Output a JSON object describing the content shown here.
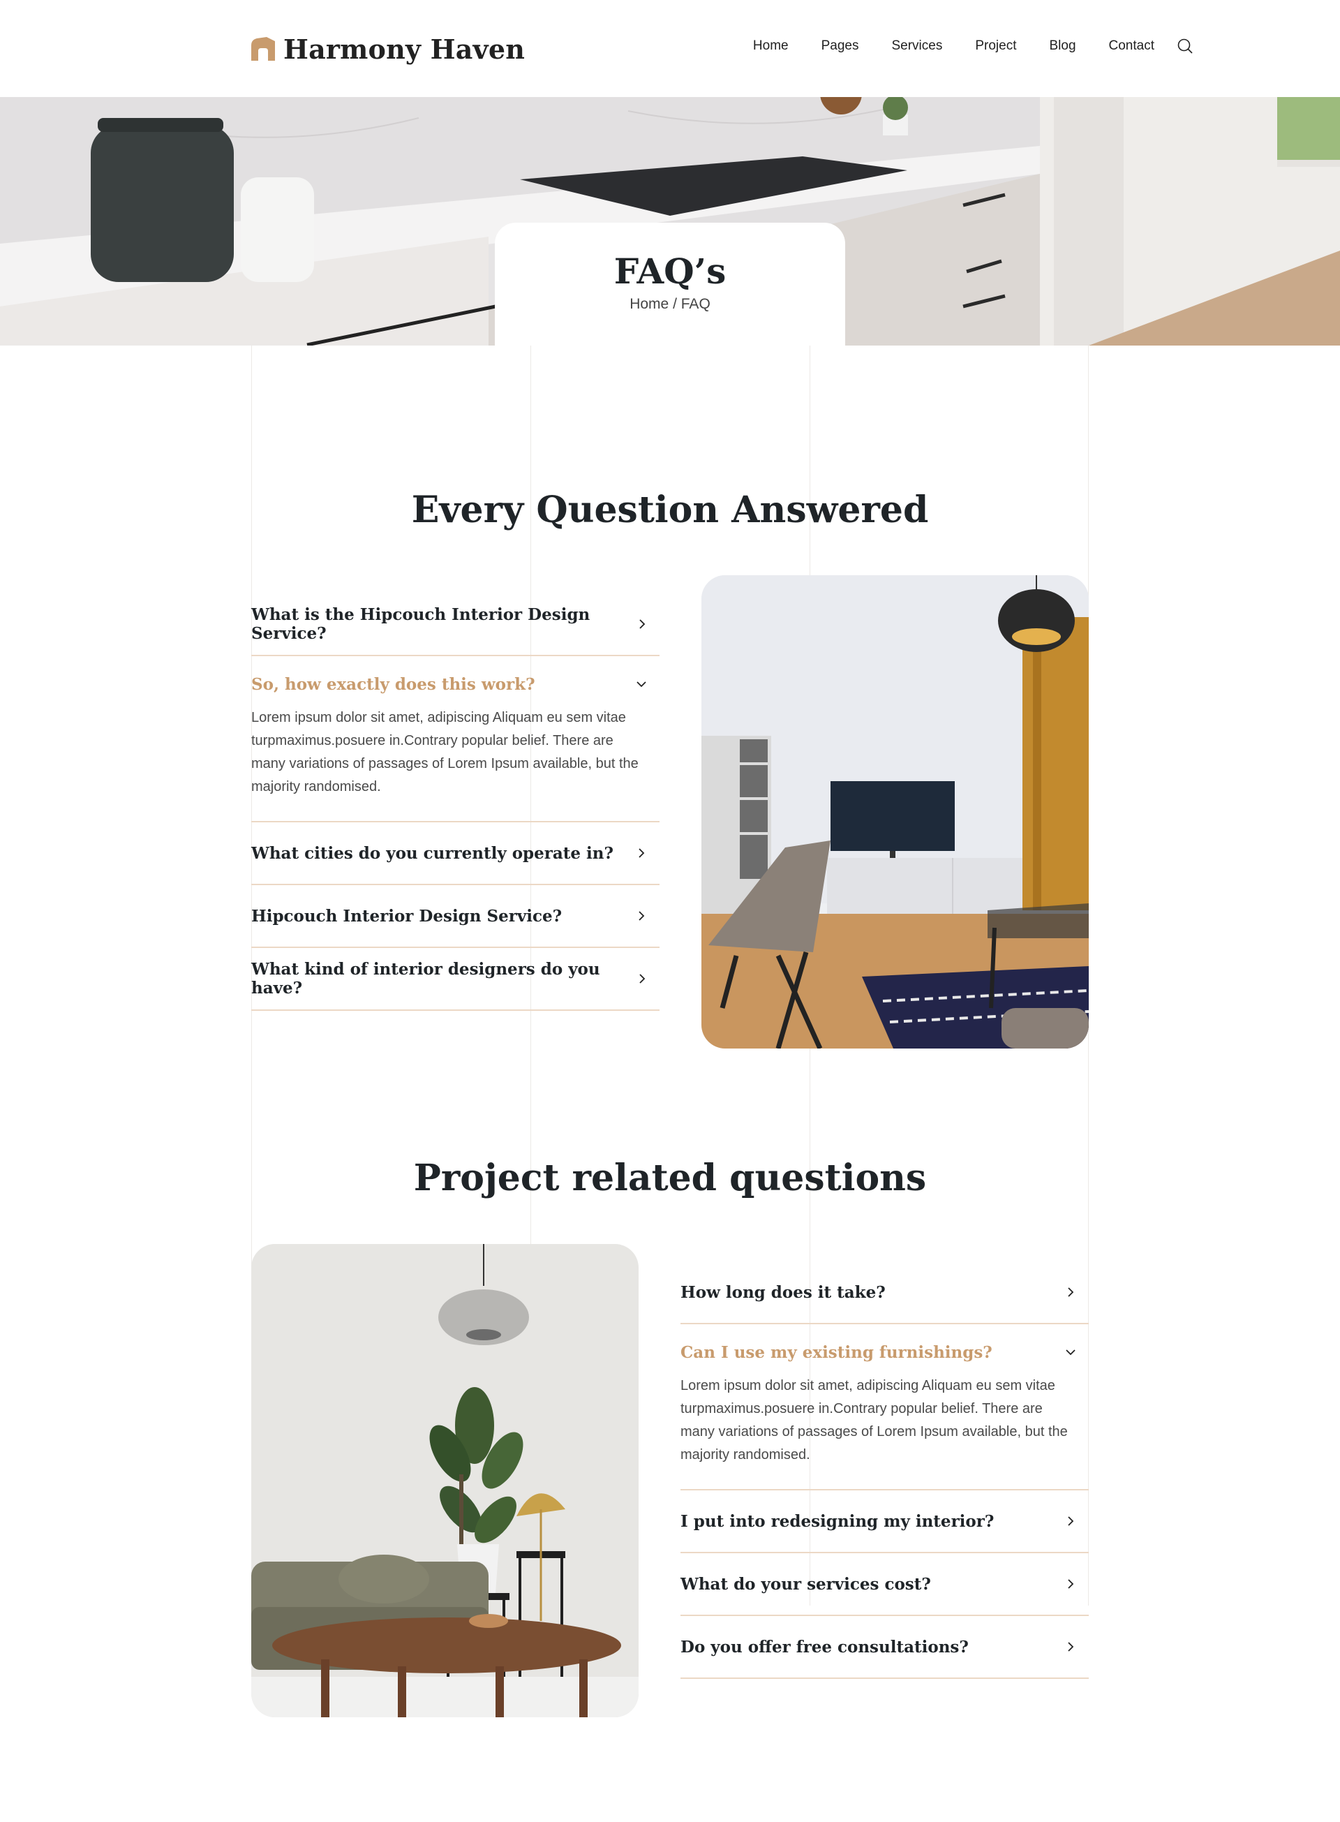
{
  "brand": {
    "name": "Harmony Haven",
    "accent": "#c89b6d"
  },
  "nav": {
    "items": [
      "Home",
      "Pages",
      "Services",
      "Project",
      "Blog",
      "Contact"
    ],
    "search_icon": "search-icon"
  },
  "hero": {
    "title": "FAQ’s",
    "breadcrumb": {
      "home": "Home",
      "separator": "/",
      "current": "FAQ"
    }
  },
  "section1": {
    "title": "Every Question Answered",
    "items": [
      {
        "q": "What is the Hipcouch Interior Design Service?",
        "open": false
      },
      {
        "q": "So, how exactly does this work?",
        "open": true,
        "a": "Lorem ipsum dolor sit amet, adipiscing Aliquam eu sem vitae turpmaximus.posuere in.Contrary popular belief. There are many variations of passages of Lorem Ipsum available, but the majority randomised."
      },
      {
        "q": "What cities do you currently operate in?",
        "open": false
      },
      {
        "q": "Hipcouch Interior Design Service?",
        "open": false
      },
      {
        "q": "What kind of interior designers do you have?",
        "open": false
      }
    ]
  },
  "section2": {
    "title": "Project related questions",
    "items": [
      {
        "q": "How long does it take?",
        "open": false
      },
      {
        "q": "Can I use my existing furnishings?",
        "open": true,
        "a": "Lorem ipsum dolor sit amet, adipiscing Aliquam eu sem vitae turpmaximus.posuere in.Contrary popular belief. There are many variations of passages of Lorem Ipsum available, but the majority randomised."
      },
      {
        "q": "I put into redesigning my interior?",
        "open": false
      },
      {
        "q": "What do your services cost?",
        "open": false
      },
      {
        "q": "Do you offer free consultations?",
        "open": false
      }
    ]
  }
}
